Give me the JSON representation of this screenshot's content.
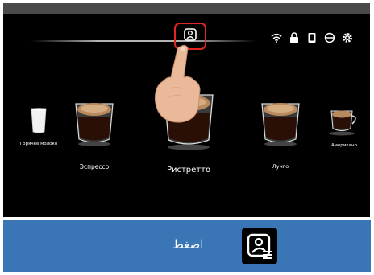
{
  "machine_screen": {
    "drinks": [
      {
        "name": "Горячее молоко"
      },
      {
        "name": "Эспрессо"
      },
      {
        "name": "Ристретто"
      },
      {
        "name": "Лунго"
      },
      {
        "name": "Американо"
      }
    ],
    "status_icons": [
      "wifi-icon",
      "lock-icon",
      "tablet-icon",
      "disconnect-icon",
      "gear-icon"
    ],
    "highlight_color": "#e0261f"
  },
  "instruction": {
    "label": "اضغط",
    "icon": "profile-card-icon",
    "background_color": "#3a76b6"
  }
}
